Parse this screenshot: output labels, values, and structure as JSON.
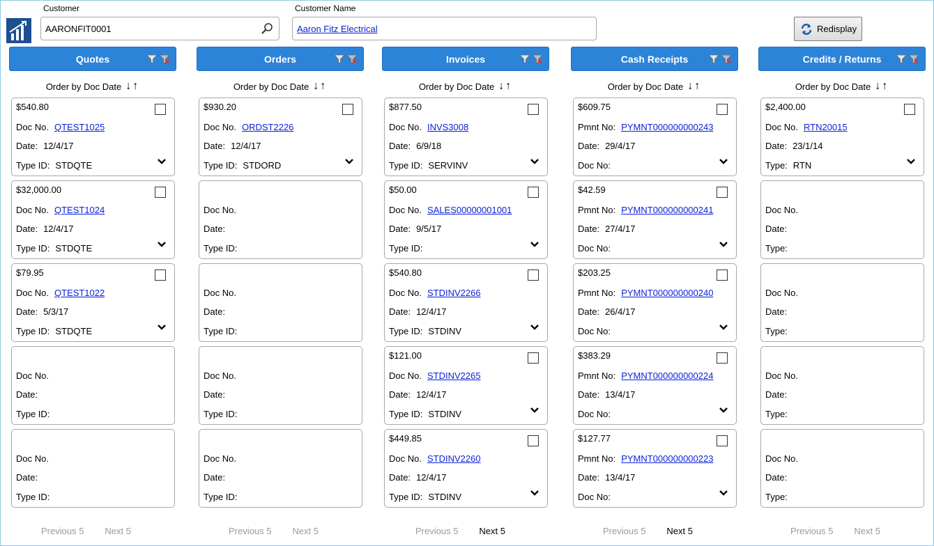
{
  "header": {
    "customer_label": "Customer",
    "customer_value": "AARONFIT0001",
    "customer_name_label": "Customer Name",
    "customer_name_value": "Aaron Fitz Electrical",
    "redisplay_label": "Redisplay"
  },
  "order_label": "Order by Doc Date",
  "columns": {
    "quotes": {
      "title": "Quotes",
      "cards": [
        {
          "amount": "$540.80",
          "doc_label": "Doc No.",
          "doc": "QTEST1025",
          "date_label": "Date:",
          "date": "12/4/17",
          "type_label": "Type ID:",
          "type": "STDQTE"
        },
        {
          "amount": "$32,000.00",
          "doc_label": "Doc No.",
          "doc": "QTEST1024",
          "date_label": "Date:",
          "date": "12/4/17",
          "type_label": "Type ID:",
          "type": "STDQTE"
        },
        {
          "amount": "$79.95",
          "doc_label": "Doc No.",
          "doc": "QTEST1022",
          "date_label": "Date:",
          "date": "5/3/17",
          "type_label": "Type ID:",
          "type": "STDQTE"
        },
        {
          "amount": "",
          "doc_label": "Doc No.",
          "doc": "",
          "date_label": "Date:",
          "date": "",
          "type_label": "Type ID:",
          "type": ""
        },
        {
          "amount": "",
          "doc_label": "Doc No.",
          "doc": "",
          "date_label": "Date:",
          "date": "",
          "type_label": "Type ID:",
          "type": ""
        }
      ],
      "prev": "Previous 5",
      "next": "Next 5",
      "next_enabled": false
    },
    "orders": {
      "title": "Orders",
      "cards": [
        {
          "amount": "$930.20",
          "doc_label": "Doc No.",
          "doc": "ORDST2226",
          "date_label": "Date:",
          "date": "12/4/17",
          "type_label": "Type ID:",
          "type": "STDORD"
        },
        {
          "amount": "",
          "doc_label": "Doc No.",
          "doc": "",
          "date_label": "Date:",
          "date": "",
          "type_label": "Type ID:",
          "type": ""
        },
        {
          "amount": "",
          "doc_label": "Doc No.",
          "doc": "",
          "date_label": "Date:",
          "date": "",
          "type_label": "Type ID:",
          "type": ""
        },
        {
          "amount": "",
          "doc_label": "Doc No.",
          "doc": "",
          "date_label": "Date:",
          "date": "",
          "type_label": "Type ID:",
          "type": ""
        },
        {
          "amount": "",
          "doc_label": "Doc No.",
          "doc": "",
          "date_label": "Date:",
          "date": "",
          "type_label": "Type ID:",
          "type": ""
        }
      ],
      "prev": "Previous 5",
      "next": "Next 5",
      "next_enabled": false
    },
    "invoices": {
      "title": "Invoices",
      "cards": [
        {
          "amount": "$877.50",
          "doc_label": "Doc No.",
          "doc": "INVS3008",
          "date_label": "Date:",
          "date": "6/9/18",
          "type_label": "Type ID:",
          "type": "SERVINV"
        },
        {
          "amount": "$50.00",
          "doc_label": "Doc No.",
          "doc": "SALES00000001001",
          "date_label": "Date:",
          "date": "9/5/17",
          "type_label": "Type ID:",
          "type": ""
        },
        {
          "amount": "$540.80",
          "doc_label": "Doc No.",
          "doc": "STDINV2266",
          "date_label": "Date:",
          "date": "12/4/17",
          "type_label": "Type ID:",
          "type": "STDINV"
        },
        {
          "amount": "$121.00",
          "doc_label": "Doc No.",
          "doc": "STDINV2265",
          "date_label": "Date:",
          "date": "12/4/17",
          "type_label": "Type ID:",
          "type": "STDINV"
        },
        {
          "amount": "$449.85",
          "doc_label": "Doc No.",
          "doc": "STDINV2260",
          "date_label": "Date:",
          "date": "12/4/17",
          "type_label": "Type ID:",
          "type": "STDINV"
        }
      ],
      "prev": "Previous 5",
      "next": "Next 5",
      "next_enabled": true
    },
    "cash_receipts": {
      "title": "Cash Receipts",
      "cards": [
        {
          "amount": "$609.75",
          "doc_label": "Pmnt No:",
          "doc": "PYMNT000000000243",
          "date_label": "Date:",
          "date": "29/4/17",
          "type_label": "Doc No:",
          "type": ""
        },
        {
          "amount": "$42.59",
          "doc_label": "Pmnt No:",
          "doc": "PYMNT000000000241",
          "date_label": "Date:",
          "date": "27/4/17",
          "type_label": "Doc No:",
          "type": ""
        },
        {
          "amount": "$203.25",
          "doc_label": "Pmnt No:",
          "doc": "PYMNT000000000240",
          "date_label": "Date:",
          "date": "26/4/17",
          "type_label": "Doc No:",
          "type": ""
        },
        {
          "amount": "$383.29",
          "doc_label": "Pmnt No:",
          "doc": "PYMNT000000000224",
          "date_label": "Date:",
          "date": "13/4/17",
          "type_label": "Doc No:",
          "type": ""
        },
        {
          "amount": "$127.77",
          "doc_label": "Pmnt No:",
          "doc": "PYMNT000000000223",
          "date_label": "Date:",
          "date": "13/4/17",
          "type_label": "Doc No:",
          "type": ""
        }
      ],
      "prev": "Previous 5",
      "next": "Next 5",
      "next_enabled": true
    },
    "credits_returns": {
      "title": "Credits / Returns",
      "cards": [
        {
          "amount": "$2,400.00",
          "doc_label": "Doc No.",
          "doc": "RTN20015",
          "date_label": "Date:",
          "date": "23/1/14",
          "type_label": "Type:",
          "type": "RTN"
        },
        {
          "amount": "",
          "doc_label": "Doc No.",
          "doc": "",
          "date_label": "Date:",
          "date": "",
          "type_label": "Type:",
          "type": ""
        },
        {
          "amount": "",
          "doc_label": "Doc No.",
          "doc": "",
          "date_label": "Date:",
          "date": "",
          "type_label": "Type:",
          "type": ""
        },
        {
          "amount": "",
          "doc_label": "Doc No.",
          "doc": "",
          "date_label": "Date:",
          "date": "",
          "type_label": "Type:",
          "type": ""
        },
        {
          "amount": "",
          "doc_label": "Doc No.",
          "doc": "",
          "date_label": "Date:",
          "date": "",
          "type_label": "Type:",
          "type": ""
        }
      ],
      "prev": "Previous 5",
      "next": "Next 5",
      "next_enabled": false
    }
  },
  "colors": {
    "header_blue": "#2b84d8",
    "link": "#0a1fd6",
    "disabled": "#9a9a9a"
  },
  "icons": [
    "app-logo-icon",
    "search-icon",
    "redisplay-icon",
    "filter-icon",
    "clear-filter-icon",
    "sort-arrows-icon",
    "chevron-down-icon"
  ]
}
